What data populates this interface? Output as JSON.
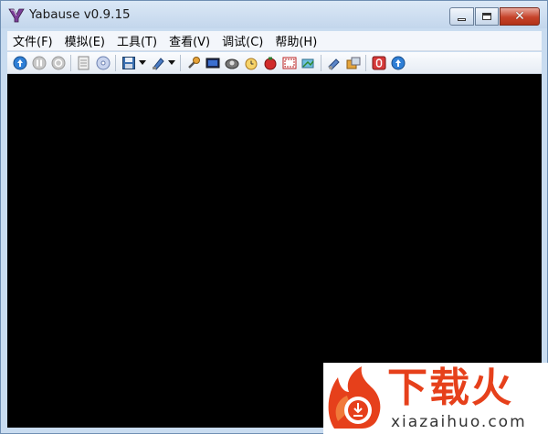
{
  "window": {
    "title": "Yabause v0.9.15",
    "close_glyph": "✕"
  },
  "menu": [
    {
      "label": "文件(F)"
    },
    {
      "label": "模拟(E)"
    },
    {
      "label": "工具(T)"
    },
    {
      "label": "查看(V)"
    },
    {
      "label": "调试(C)"
    },
    {
      "label": "帮助(H)"
    }
  ],
  "toolbar": {
    "icons": [
      "run-icon",
      "pause-icon",
      "reset-icon",
      "open-iso-icon",
      "open-cd-icon",
      "save-state-icon",
      "load-state-icon",
      "settings-icon",
      "screenshot-icon",
      "cheat-icon",
      "alarm-icon",
      "record-icon",
      "fullscreen-icon",
      "layers-icon",
      "video-record-icon",
      "capture-icon",
      "stop-icon",
      "info-icon"
    ]
  },
  "watermark": {
    "title": "下载火",
    "url": "xiazaihuo.com",
    "color": "#e6401b"
  },
  "colors": {
    "display_bg": "#000000",
    "frame": "#c9dcf0"
  }
}
